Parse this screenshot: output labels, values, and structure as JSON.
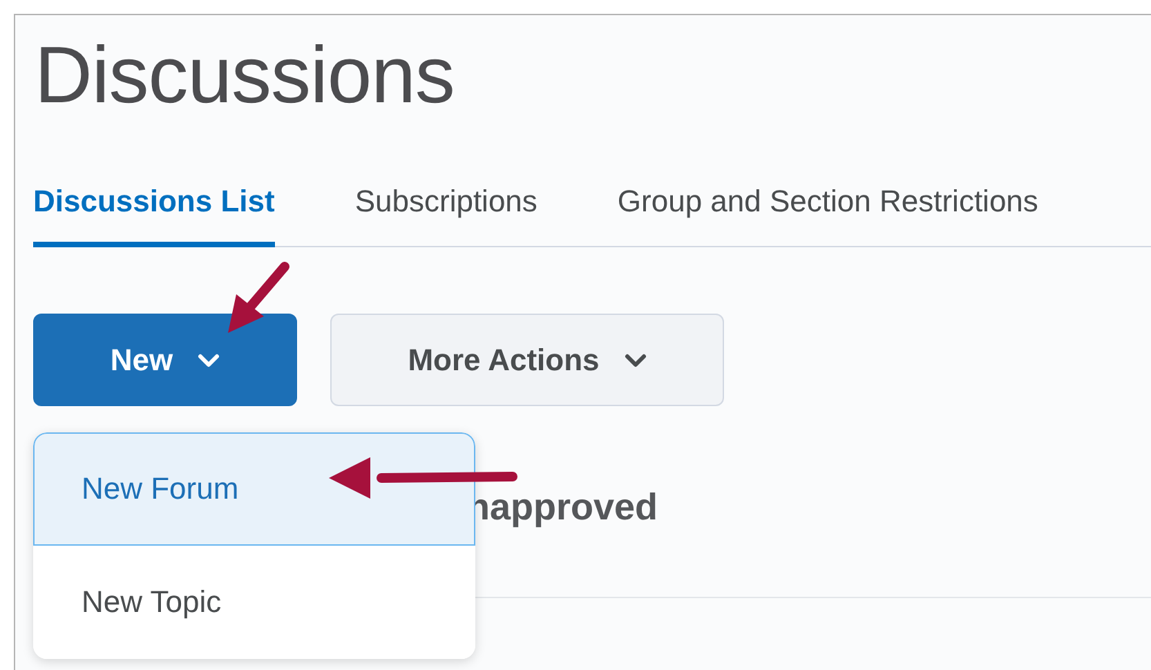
{
  "page": {
    "title": "Discussions"
  },
  "tabs": [
    {
      "label": "Discussions List",
      "selected": true
    },
    {
      "label": "Subscriptions",
      "selected": false
    },
    {
      "label": "Group and Section Restrictions",
      "selected": false
    }
  ],
  "toolbar": {
    "buttons": [
      {
        "label": "New",
        "kind": "primary"
      },
      {
        "label": "More Actions",
        "kind": "secondary"
      }
    ]
  },
  "dropdown": {
    "items": [
      {
        "label": "New Forum",
        "selected": true
      },
      {
        "label": "New Topic",
        "selected": false
      }
    ]
  },
  "filter_label": "napproved"
}
